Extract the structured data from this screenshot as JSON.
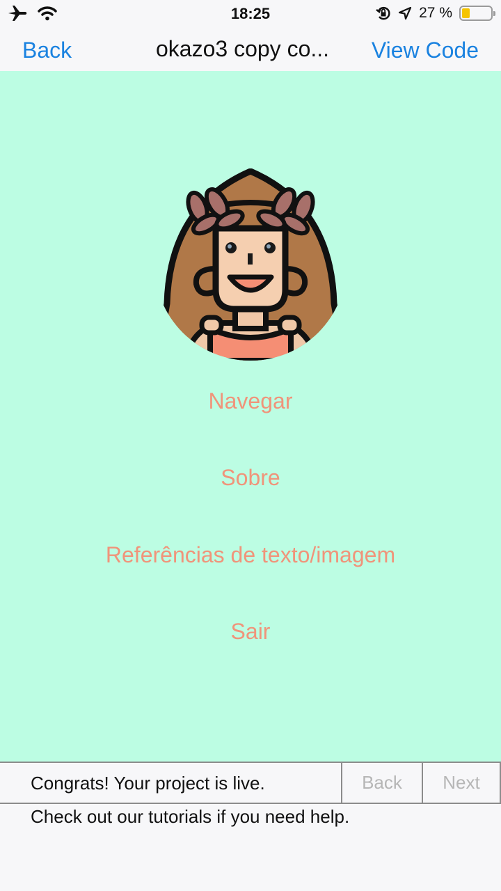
{
  "status_bar": {
    "time": "18:25",
    "battery_text": "27 %",
    "battery_level": 0.27,
    "icons": [
      "airplane-icon",
      "wifi-icon",
      "rotation-lock-icon",
      "location-icon",
      "battery-icon"
    ]
  },
  "nav": {
    "back_label": "Back",
    "title": "okazo3 copy co...",
    "view_code_label": "View Code",
    "accent_color": "#1a82e0"
  },
  "app": {
    "background_color": "#bcfde3",
    "menu_color": "#f0947a",
    "menu_items": [
      {
        "label": "Navegar"
      },
      {
        "label": "Sobre"
      },
      {
        "label": "Referências de texto/imagem"
      },
      {
        "label": "Sair"
      }
    ]
  },
  "banner": {
    "message": "Congrats! Your project is live.",
    "help": "Check out our tutorials if you need help.",
    "back_label": "Back",
    "next_label": "Next"
  }
}
